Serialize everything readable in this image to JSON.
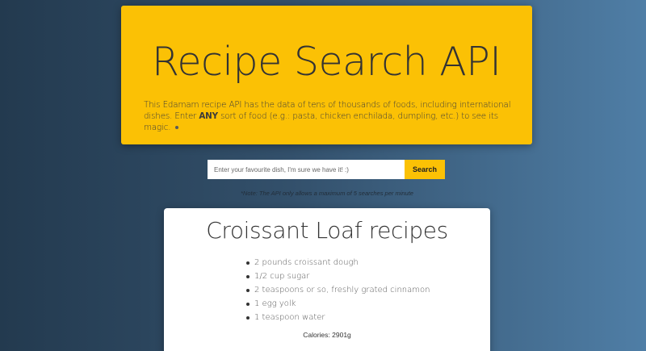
{
  "hero": {
    "title": "Recipe Search API",
    "description_part1": "This Edamam recipe API has the data of tens of thousands of foods, including international dishes. Enter ",
    "description_emphasis": "ANY",
    "description_part2": " sort of food (e.g.: pasta, chicken enchilada, dumpling, etc.) to see its magic."
  },
  "search": {
    "placeholder": "Enter your favourite dish, I'm sure we have it! :)",
    "value": "",
    "button_label": "Search"
  },
  "note": "*Note: The API only allows a maximum of 5 searches per minute",
  "recipe": {
    "title": "Croissant Loaf recipes",
    "ingredients": [
      "2 pounds croissant dough",
      "1/2 cup sugar",
      "2 teaspoons or so, freshly grated cinnamon",
      "1 egg yolk",
      "1 teaspoon water"
    ],
    "calories_label": "Calories:",
    "calories_value": "2901g"
  },
  "colors": {
    "accent": "#fbc105",
    "background_start": "#233a4f",
    "background_end": "#4f7ea6",
    "card": "#ffffff"
  }
}
